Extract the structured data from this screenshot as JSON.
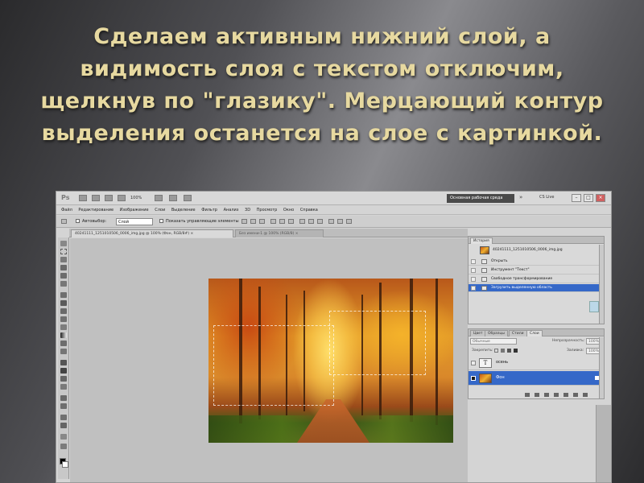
{
  "slide": {
    "title": "Сделаем активным нижний слой, а видимость слоя с текстом отключим, щелкнув по \"глазику\". Мерцающий контур выделения останется на слое с картинкой."
  },
  "photoshop": {
    "logo": "Ps",
    "zoom": "100%",
    "workspace_label": "Основная рабочая среда",
    "workspace_more": "»",
    "cs_live": "CS Live",
    "window_buttons": [
      "–",
      "□",
      "×"
    ],
    "menu": [
      "Файл",
      "Редактирование",
      "Изображение",
      "Слои",
      "Выделение",
      "Фильтр",
      "Анализ",
      "3D",
      "Просмотр",
      "Окно",
      "Справка"
    ],
    "options": {
      "autoselect_label": "Автовыбор:",
      "autoselect_value": "Слой",
      "show_controls_label": "Показать управляющие элементы"
    },
    "document_tabs": [
      {
        "label": "40241111_1251010506_0006_img.jpg @ 100% (Фон, RGB/8#) ×",
        "active": true
      },
      {
        "label": "Без имени-1 @ 100% (RGB/8) ×",
        "active": false
      }
    ],
    "history_panel": {
      "tab": "История",
      "snapshot": "40241111_1251010506_0006_img.jpg",
      "items": [
        {
          "label": "Открыть",
          "selected": false
        },
        {
          "label": "Инструмент \"Текст\"",
          "selected": false
        },
        {
          "label": "Свободное трансформирование",
          "selected": false
        },
        {
          "label": "Загрузить выделенную область",
          "selected": true
        }
      ]
    },
    "layers_panel": {
      "tabs": [
        "Цвет",
        "Образцы",
        "Стили",
        "Слои"
      ],
      "active_tab": "Слои",
      "kind_dropdown": "Обычные",
      "opacity_label": "Непрозрачность:",
      "opacity_value": "100%",
      "lock_label": "Закрепить:",
      "fill_label": "Заливка:",
      "fill_value": "100%",
      "layers": [
        {
          "name": "осень",
          "type": "text",
          "thumb_text": "T",
          "visible": false,
          "selected": false
        },
        {
          "name": "Фон",
          "type": "image",
          "visible": true,
          "selected": true
        }
      ]
    }
  }
}
